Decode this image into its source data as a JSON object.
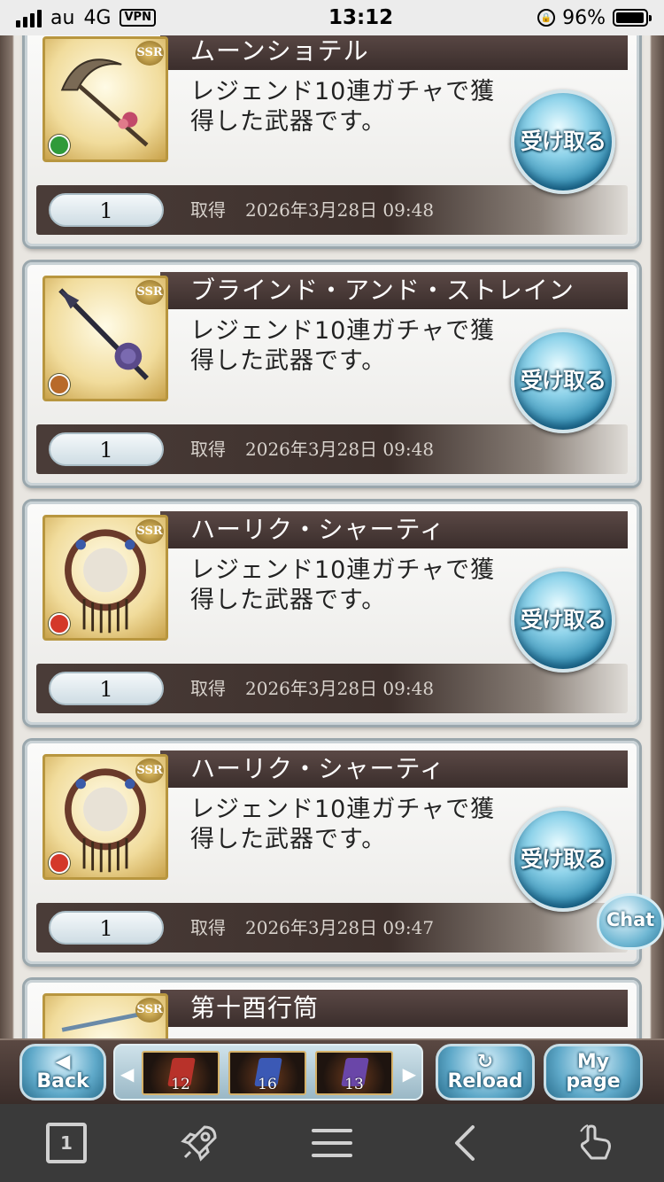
{
  "status": {
    "carrier": "au",
    "network": "4G",
    "vpn": "VPN",
    "time": "13:12",
    "battery": "96%",
    "battery_level": 0.96
  },
  "items": [
    {
      "name": "ムーンショテル",
      "rarity": "SSR",
      "element": "wind",
      "element_color": "#2f9a3a",
      "desc_line1": "レジェンド10連ガチャで獲",
      "desc_line2": "得した武器です。",
      "qty": "1",
      "obtained_label": "取得",
      "obtained_date": "2026年3月28日 09:48",
      "button": "受け取る"
    },
    {
      "name": "ブラインド・アンド・ストレイン",
      "rarity": "SSR",
      "element": "earth",
      "element_color": "#b86a2a",
      "desc_line1": "レジェンド10連ガチャで獲",
      "desc_line2": "得した武器です。",
      "qty": "1",
      "obtained_label": "取得",
      "obtained_date": "2026年3月28日 09:48",
      "button": "受け取る"
    },
    {
      "name": "ハーリク・シャーティ",
      "rarity": "SSR",
      "element": "fire",
      "element_color": "#d4382a",
      "desc_line1": "レジェンド10連ガチャで獲",
      "desc_line2": "得した武器です。",
      "qty": "1",
      "obtained_label": "取得",
      "obtained_date": "2026年3月28日 09:48",
      "button": "受け取る"
    },
    {
      "name": "ハーリク・シャーティ",
      "rarity": "SSR",
      "element": "fire",
      "element_color": "#d4382a",
      "desc_line1": "レジェンド10連ガチャで獲",
      "desc_line2": "得した武器です。",
      "qty": "1",
      "obtained_label": "取得",
      "obtained_date": "2026年3月28日 09:47",
      "button": "受け取る"
    },
    {
      "name": "第十酉行筒",
      "rarity": "SSR"
    }
  ],
  "chat": {
    "label": "Chat"
  },
  "gamebar": {
    "back": "Back",
    "reload": "Reload",
    "mypage_line1": "My",
    "mypage_line2": "page",
    "items": [
      {
        "count": "12",
        "gem_color": "#b8322a"
      },
      {
        "count": "16",
        "gem_color": "#3b59b5"
      },
      {
        "count": "13",
        "gem_color": "#6a46a8"
      }
    ]
  },
  "toolbar": {
    "tab_count": "1",
    "icons": [
      "tabs-icon",
      "rocket-icon",
      "menu-icon",
      "back-arrow-icon",
      "gesture-hand-icon"
    ]
  }
}
